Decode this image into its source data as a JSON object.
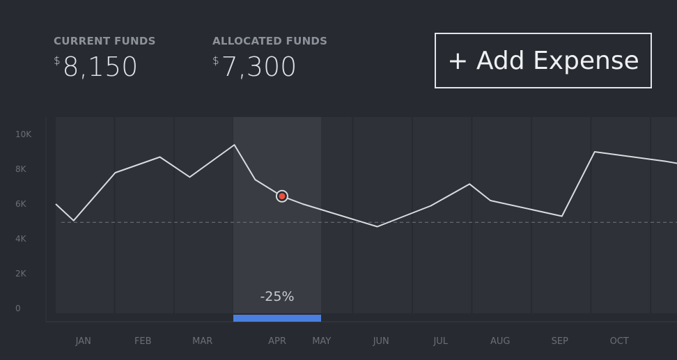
{
  "stats": {
    "current_label": "CURRENT FUNDS",
    "current_currency": "$",
    "current_value": "8,150",
    "allocated_label": "ALLOCATED FUNDS",
    "allocated_currency": "$",
    "allocated_value": "7,300"
  },
  "add_button_label": "+ Add Expense",
  "chart_data": {
    "type": "line",
    "title": "",
    "xlabel": "",
    "ylabel": "",
    "categories": [
      "JAN",
      "FEB",
      "MAR",
      "APR",
      "MAY",
      "JUN",
      "JUL",
      "AUG",
      "SEP",
      "OCT"
    ],
    "y_ticks": [
      "0",
      "2K",
      "4K",
      "6K",
      "8K",
      "10K"
    ],
    "ylim": [
      0,
      10000
    ],
    "xlim": [
      0,
      10.5
    ],
    "grid": false,
    "series": [
      {
        "x": [
          0.0,
          0.3,
          1.0,
          1.75,
          2.25,
          3.0,
          3.35,
          3.8,
          4.15,
          5.4,
          6.3,
          6.95,
          7.3,
          8.5,
          9.05,
          10.25,
          10.5
        ],
        "y": [
          6000,
          5050,
          7800,
          8700,
          7550,
          9400,
          7400,
          6450,
          6000,
          4700,
          5900,
          7150,
          6200,
          5300,
          9000,
          8450,
          8300
        ]
      }
    ],
    "reference_line": 4950,
    "highlight": {
      "category": "APR",
      "label": "-25%",
      "marker": {
        "x": 3.8,
        "y": 6450
      }
    },
    "colors": {
      "background": "#272a31",
      "column": "#2e3138",
      "highlight_column": "#393c43",
      "line": "#d9dcdf",
      "marker": "#e8513f",
      "highlight_bar": "#4a7fe0",
      "axis_text": "#6b6f77",
      "reference_line": "#73777e"
    }
  }
}
